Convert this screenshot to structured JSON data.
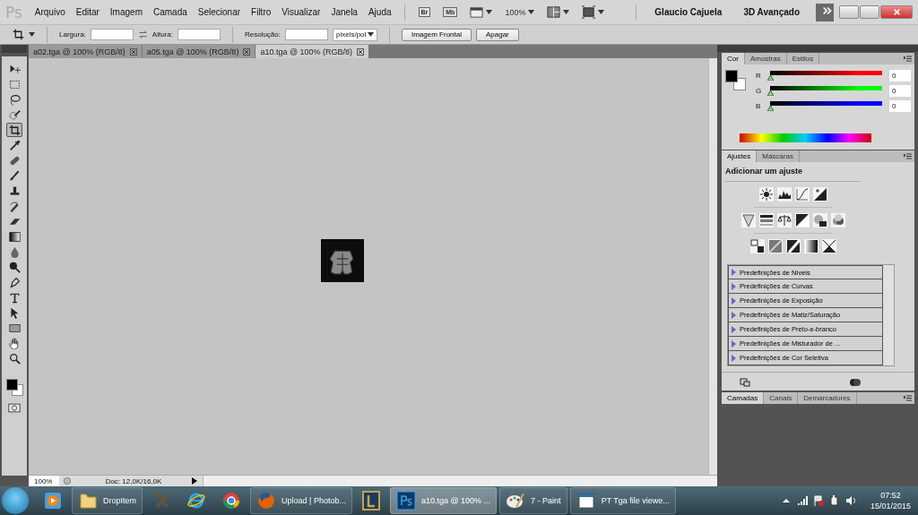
{
  "menu_bar": {
    "logo": "Ps",
    "items": [
      "Arquivo",
      "Editar",
      "Imagem",
      "Camada",
      "Selecionar",
      "Filtro",
      "Visualizar",
      "Janela",
      "Ajuda"
    ],
    "tools": [
      {
        "kind": "bridge",
        "label": "Br"
      },
      {
        "kind": "minibridge",
        "label": "Mb"
      },
      {
        "kind": "extras"
      },
      {
        "kind": "zoom",
        "label": "100%"
      },
      {
        "kind": "arrange"
      },
      {
        "kind": "screen"
      }
    ],
    "user": "Glaucio Cajuela",
    "workspace": "3D Avançado"
  },
  "options_bar": {
    "fields": [
      {
        "label": "Largura:"
      },
      {
        "label": "Altura:"
      },
      {
        "label": "Resolução:"
      }
    ],
    "unit": "pixels/pol",
    "buttons": [
      "Imagem Frontal",
      "Apagar"
    ]
  },
  "document_tabs": [
    {
      "label": "a02.tga @ 100% (RGB/8)",
      "selected": false
    },
    {
      "label": "a05.tga @ 100% (RGB/8)",
      "selected": false
    },
    {
      "label": "a10.tga @ 100% (RGB/8)",
      "selected": true
    }
  ],
  "tools": [
    {
      "kind": "move",
      "selected": false
    },
    {
      "kind": "marquee",
      "selected": false
    },
    {
      "kind": "lasso",
      "selected": false
    },
    {
      "kind": "quick-select",
      "selected": false
    },
    {
      "kind": "crop",
      "selected": true
    },
    {
      "kind": "eyedropper",
      "selected": false
    },
    {
      "kind": "healing",
      "selected": false
    },
    {
      "kind": "brush",
      "selected": false
    },
    {
      "kind": "stamp",
      "selected": false
    },
    {
      "kind": "history-brush",
      "selected": false
    },
    {
      "kind": "eraser",
      "selected": false
    },
    {
      "kind": "gradient",
      "selected": false
    },
    {
      "kind": "blur",
      "selected": false
    },
    {
      "kind": "dodge",
      "selected": false
    },
    {
      "kind": "pen",
      "selected": false
    },
    {
      "kind": "type",
      "selected": false
    },
    {
      "kind": "path-select",
      "selected": false
    },
    {
      "kind": "shape",
      "selected": false
    },
    {
      "kind": "hand",
      "selected": false
    },
    {
      "kind": "zoom",
      "selected": false
    }
  ],
  "color_panel": {
    "tabs": [
      {
        "label": "Cor",
        "selected": true
      },
      {
        "label": "Amostras",
        "selected": false
      },
      {
        "label": "Estilos",
        "selected": false
      }
    ],
    "channels": [
      {
        "name": "R",
        "color": "#ff0000",
        "level": 0,
        "value": "0"
      },
      {
        "name": "G",
        "color": "#00ff00",
        "level": 0,
        "value": "0"
      },
      {
        "name": "B",
        "color": "#0000ff",
        "level": 0,
        "value": "0"
      }
    ]
  },
  "adjustments_panel": {
    "tabs": [
      {
        "label": "Ajustes",
        "selected": true
      },
      {
        "label": "Máscaras",
        "selected": false
      }
    ],
    "heading": "Adicionar um ajuste",
    "icon_rows": [
      [
        {
          "kind": "brightness"
        },
        {
          "kind": "levels"
        },
        {
          "kind": "curves"
        },
        {
          "kind": "exposure"
        }
      ],
      [
        {
          "kind": "vibrance"
        },
        {
          "kind": "hue"
        },
        {
          "kind": "balance"
        },
        {
          "kind": "black-white"
        },
        {
          "kind": "photo-filter"
        },
        {
          "kind": "mixer"
        }
      ],
      [
        {
          "kind": "invert"
        },
        {
          "kind": "posterize"
        },
        {
          "kind": "threshold"
        },
        {
          "kind": "gradient-map"
        },
        {
          "kind": "selective"
        }
      ]
    ],
    "presets": [
      "Predefinições de Níveis",
      "Predefinições de Curvas",
      "Predefinições de Exposição",
      "Predefinições de Matiz/Saturação",
      "Predefinições de Preto-e-branco",
      "Predefinições de Misturador de ...",
      "Predefinições de Cor Seletiva"
    ]
  },
  "layers_panel": {
    "tabs": [
      {
        "label": "Camadas",
        "selected": true
      },
      {
        "label": "Canais",
        "selected": false
      },
      {
        "label": "Demarcadores",
        "selected": false
      }
    ]
  },
  "status_bar": {
    "zoom": "100%",
    "doc": "Doc: 12,0K/16,0K"
  },
  "taskbar": {
    "items": [
      {
        "kind": "media",
        "selected": false
      },
      {
        "kind": "folder",
        "label": "DropItem",
        "selected": false
      },
      {
        "kind": "game",
        "selected": false
      },
      {
        "kind": "ie",
        "selected": false
      },
      {
        "kind": "chrome",
        "selected": false
      },
      {
        "kind": "firefox",
        "label": "Upload | Photob...",
        "selected": false
      },
      {
        "kind": "lol",
        "selected": false
      },
      {
        "kind": "ps",
        "label": "a10.tga @ 100% ...",
        "selected": true
      },
      {
        "kind": "paint",
        "label": "7 - Paint",
        "selected": false
      },
      {
        "kind": "viewer",
        "label": "PT Tga file viewe...",
        "selected": false
      }
    ],
    "time": "07:52",
    "date": "15/01/2015"
  }
}
